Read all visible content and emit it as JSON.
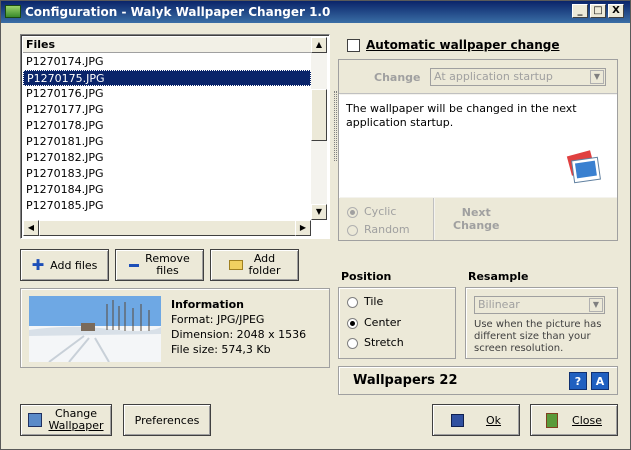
{
  "window": {
    "title": "Configuration - Walyk Wallpaper Changer 1.0",
    "controls": {
      "minimize": "_",
      "maximize": "□",
      "close": "X"
    }
  },
  "files": {
    "header": "Files",
    "items": [
      "P1270174.JPG",
      "P1270175.JPG",
      "P1270176.JPG",
      "P1270177.JPG",
      "P1270178.JPG",
      "P1270181.JPG",
      "P1270182.JPG",
      "P1270183.JPG",
      "P1270184.JPG",
      "P1270185.JPG"
    ],
    "selected_index": 1
  },
  "file_buttons": {
    "add_files": "Add files",
    "remove_files_line1": "Remove",
    "remove_files_line2": "files",
    "add_folder_line1": "Add",
    "add_folder_line2": "folder"
  },
  "info": {
    "heading": "Information",
    "format": "Format: JPG/JPEG",
    "dimension": "Dimension: 2048 x 1536",
    "file_size": "File size: 574,3 Kb"
  },
  "auto_change": {
    "checkbox_label": "Automatic wallpaper change",
    "checked": false,
    "change_label": "Change",
    "change_value": "At application startup",
    "message": "The wallpaper will be changed in the next application startup.",
    "cyclic": "Cyclic",
    "random": "Random",
    "cyclic_selected": true,
    "next_change_line1": "Next",
    "next_change_line2": "Change"
  },
  "position": {
    "heading": "Position",
    "options": [
      "Tile",
      "Center",
      "Stretch"
    ],
    "selected": "Center"
  },
  "resample": {
    "heading": "Resample",
    "value": "Bilinear",
    "note": "Use when the picture has different size than your screen resolution."
  },
  "status": {
    "wallpapers_text": "Wallpapers 22",
    "help_glyph": "?",
    "about_glyph": "A"
  },
  "bottom_buttons": {
    "change_wallpaper_line1": "Change",
    "change_wallpaper_line2": "Wallpaper",
    "preferences": "Preferences",
    "ok": "Ok",
    "close": "Close"
  },
  "colors": {
    "title_gradient_start": "#0a246a",
    "selection": "#0a246a",
    "face": "#ece9d8",
    "help_blue": "#2060c0"
  }
}
